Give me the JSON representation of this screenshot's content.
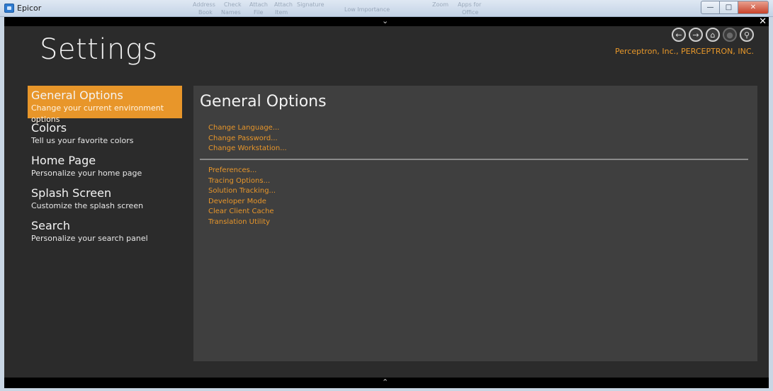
{
  "window": {
    "title": "Epicor",
    "minimize_label": "—",
    "maximize_label": "□",
    "close_label": "✕",
    "ghost_text": [
      "Address",
      "Check",
      "Attach",
      "Attach",
      "Signature",
      "Low Importance",
      "Zoom",
      "Apps for",
      "Book",
      "Names",
      "File",
      "Item",
      "Office"
    ]
  },
  "frame": {
    "collapse_top": "⌄",
    "collapse_bottom": "⌃",
    "close": "✕"
  },
  "header": {
    "title": "Settings",
    "company": "Perceptron, Inc., PERCEPTRON, INC.",
    "nav": [
      {
        "icon": "back-arrow-icon",
        "glyph": "←",
        "enabled": true
      },
      {
        "icon": "forward-arrow-icon",
        "glyph": "→",
        "enabled": true
      },
      {
        "icon": "home-icon",
        "glyph": "⌂",
        "enabled": true
      },
      {
        "icon": "stop-icon",
        "glyph": "●",
        "enabled": false
      },
      {
        "icon": "search-icon",
        "glyph": "⚲",
        "enabled": true
      }
    ]
  },
  "sidebar": {
    "items": [
      {
        "title": "General Options",
        "subtitle": "Change your current environment options",
        "active": true
      },
      {
        "title": "Colors",
        "subtitle": "Tell us your favorite colors",
        "active": false
      },
      {
        "title": "Home Page",
        "subtitle": "Personalize your home page",
        "active": false
      },
      {
        "title": "Splash Screen",
        "subtitle": "Customize the splash screen",
        "active": false
      },
      {
        "title": "Search",
        "subtitle": "Personalize your search panel",
        "active": false
      }
    ]
  },
  "main": {
    "title": "General Options",
    "group1": [
      "Change Language...",
      "Change Password...",
      "Change Workstation..."
    ],
    "group2": [
      "Preferences...",
      "Tracing Options...",
      "Solution Tracking...",
      "Developer Mode",
      "Clear Client Cache",
      "Translation Utility"
    ]
  },
  "colors": {
    "accent": "#e8962a",
    "background": "#2b2b2b",
    "panel": "#3f3f3f"
  }
}
